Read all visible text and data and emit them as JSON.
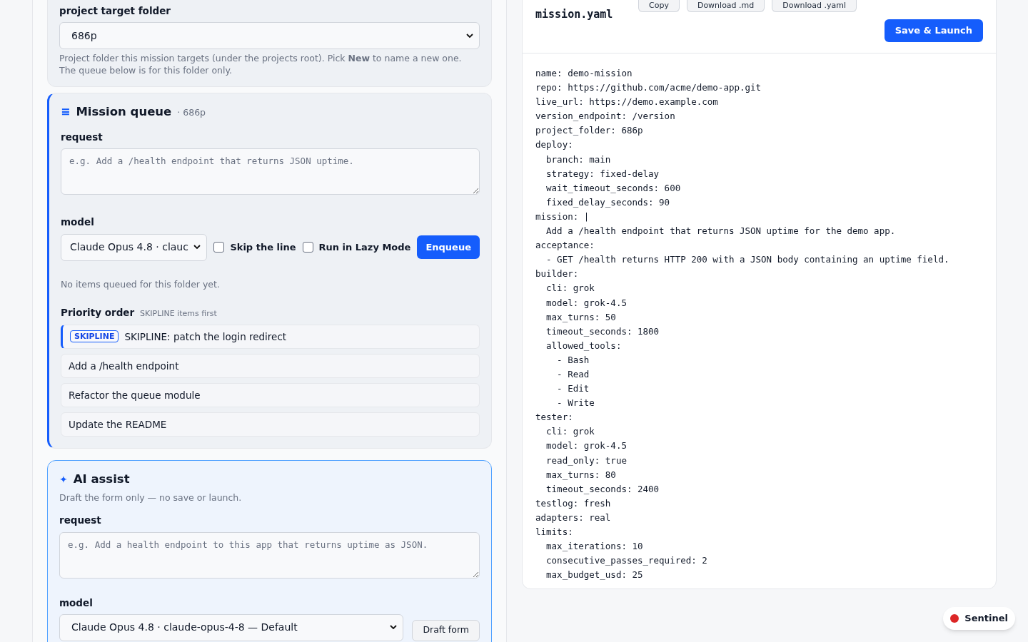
{
  "project_folder": {
    "label": "project target folder",
    "value": "686p",
    "help": "Project folder this mission targets (under the projects root). Pick **New** to name a new one. The queue below is for this folder only."
  },
  "queue": {
    "icon": "≡",
    "title": "Mission queue",
    "folder": "· 686p",
    "request_label": "request",
    "request_placeholder": "e.g. Add a /health endpoint that returns JSON uptime.",
    "model_label": "model",
    "model_value": "Claude Opus 4.8 · clauc",
    "skip_line": {
      "label": "Skip the line",
      "checked": false
    },
    "lazy_mode": {
      "label": "Run in Lazy Mode",
      "checked": false
    },
    "enqueue": "Enqueue",
    "empty": "No items queued for this folder yet.",
    "priority_title": "Priority order",
    "priority_hint": "SKIPLINE items first",
    "items": [
      {
        "badge": "SKIPLINE",
        "text": "SKIPLINE: patch the login redirect",
        "skipline": true
      },
      {
        "text": "Add a /health endpoint",
        "skipline": false
      },
      {
        "text": "Refactor the queue module",
        "skipline": false
      },
      {
        "text": "Update the README",
        "skipline": false
      }
    ]
  },
  "assist": {
    "icon": "✦",
    "title": "AI assist",
    "subtitle": "Draft the form only — no save or launch.",
    "request_label": "request",
    "request_placeholder": "e.g. Add a health endpoint to this app that returns uptime as JSON.",
    "model_label": "model",
    "model_value": "Claude Opus 4.8 · claude-opus-4-8 — Default",
    "draft": "Draft form"
  },
  "yaml_panel": {
    "title": "mission.yaml",
    "buttons": [
      "Copy",
      "Download .md",
      "Download .yaml"
    ],
    "launch": "Save & Launch",
    "lines": [
      "name: demo-mission",
      "repo: https://github.com/acme/demo-app.git",
      "live_url: https://demo.example.com",
      "version_endpoint: /version",
      "project_folder: 686p",
      "deploy:",
      "  branch: main",
      "  strategy: fixed-delay",
      "  wait_timeout_seconds: 600",
      "  fixed_delay_seconds: 90",
      "mission: |",
      "  Add a /health endpoint that returns JSON uptime for the demo app.",
      "acceptance:",
      "  - GET /health returns HTTP 200 with a JSON body containing an uptime field.",
      "builder:",
      "  cli: grok",
      "  model: grok-4.5",
      "  max_turns: 50",
      "  timeout_seconds: 1800",
      "  allowed_tools:",
      "    - Bash",
      "    - Read",
      "    - Edit",
      "    - Write",
      "tester:",
      "  cli: grok",
      "  model: grok-4.5",
      "  read_only: true",
      "  max_turns: 80",
      "  timeout_seconds: 2400",
      "testlog: fresh",
      "adapters: real",
      "limits:",
      "  max_iterations: 10",
      "  consecutive_passes_required: 2",
      "  max_budget_usd: 25"
    ]
  },
  "status_pill": {
    "label": "Sentinel",
    "color": "#dc2626"
  }
}
